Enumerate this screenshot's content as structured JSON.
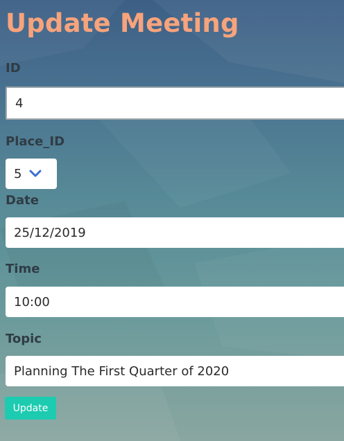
{
  "page": {
    "title": "Update Meeting"
  },
  "form": {
    "id": {
      "label": "ID",
      "value": "4"
    },
    "place_id": {
      "label": "Place_ID",
      "value": "5"
    },
    "date": {
      "label": "Date",
      "value": "25/12/2019"
    },
    "time": {
      "label": "Time",
      "value": "10:00"
    },
    "topic": {
      "label": "Topic",
      "value": "Planning The First Quarter of 2020"
    },
    "submit_label": "Update"
  },
  "colors": {
    "title": "#f7a37c",
    "button": "#1ccbb0",
    "chevron": "#3a6fd1"
  }
}
